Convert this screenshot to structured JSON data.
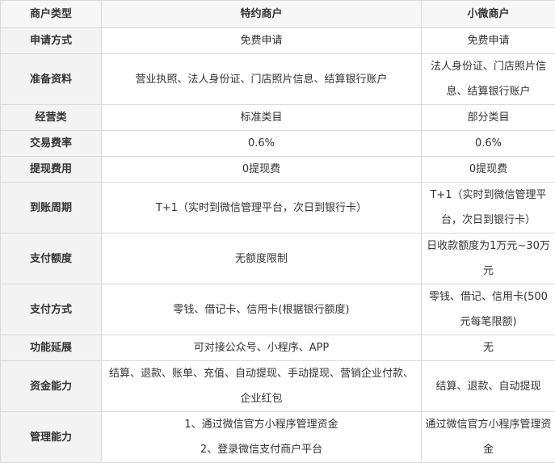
{
  "columns": [
    "商户类型",
    "特约商户",
    "小微商户"
  ],
  "rows": [
    {
      "label": "申请方式",
      "special": "免费申请",
      "micro": "免费申请"
    },
    {
      "label": "准备资料",
      "special": "营业执照、法人身份证、门店照片信息、结算银行账户",
      "micro": "法人身份证、门店照片信息、结算银行账户"
    },
    {
      "label": "经营类",
      "special": "标准类目",
      "micro": "部分类目"
    },
    {
      "label": "交易费率",
      "special": "0.6%",
      "micro": "0.6%"
    },
    {
      "label": "提现费用",
      "special": "0提现费",
      "micro": "0提现费"
    },
    {
      "label": "到账周期",
      "special": "T+1（实时到微信管理平台，次日到银行卡）",
      "micro": "T+1（实时到微信管理平台，次日到银行卡）"
    },
    {
      "label": "支付额度",
      "special": "无额度限制",
      "micro": "日收款额度为1万元~30万元"
    },
    {
      "label": "支付方式",
      "special": "零钱、借记卡、信用卡(根据银行额度)",
      "micro": "零钱、借记、信用卡(500元每笔限额)"
    },
    {
      "label": "功能延展",
      "special": "可对接公众号、小程序、APP",
      "micro": "无"
    },
    {
      "label": "资金能力",
      "special": "结算、退款、账单、充值、自动提现、手动提现、营销企业付款、企业红包",
      "micro": "结算、退款、自动提现"
    },
    {
      "label": "管理能力",
      "special": "1、通过微信官方小程序管理资金\n2、登录微信支付商户平台",
      "micro": "通过微信官方小程序管理资金"
    }
  ]
}
